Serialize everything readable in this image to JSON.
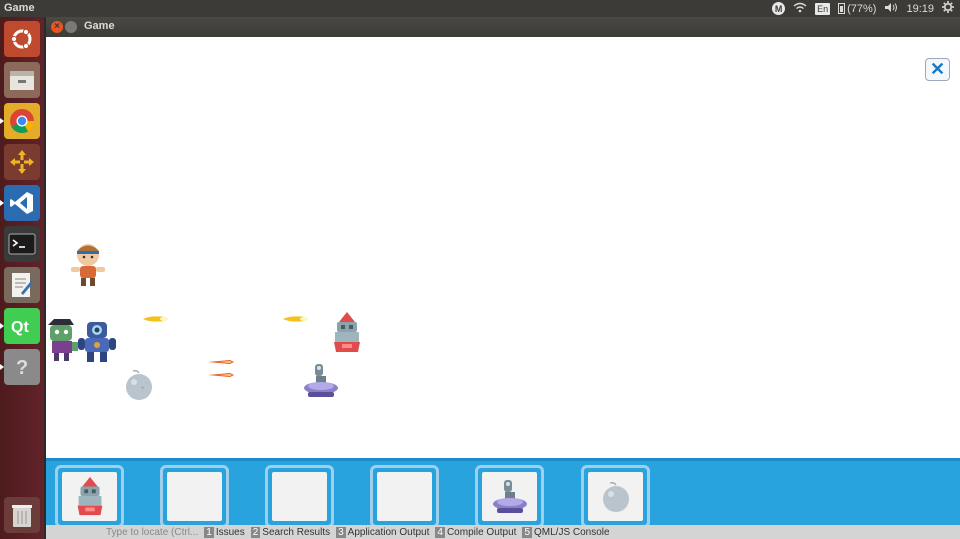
{
  "top_panel": {
    "app_title": "Game",
    "indicator_m": "M",
    "language": "En",
    "battery": "(77%)",
    "time": "19:19"
  },
  "launcher": {
    "items": [
      {
        "name": "ubuntu-dash-icon"
      },
      {
        "name": "files-icon"
      },
      {
        "name": "chrome-icon"
      },
      {
        "name": "game-app-icon"
      },
      {
        "name": "vscode-icon"
      },
      {
        "name": "terminal-icon"
      },
      {
        "name": "text-editor-icon"
      },
      {
        "name": "qt-creator-icon"
      },
      {
        "name": "unknown-app-icon"
      },
      {
        "name": "trash-icon"
      }
    ]
  },
  "window": {
    "title": "Game",
    "close_glyph": "×",
    "exit_glyph": "✕"
  },
  "game": {
    "enemies": [
      "hero-warrior",
      "zombie",
      "robot"
    ],
    "towers_on_field": [
      "red-turret",
      "laser-tower",
      "bomb"
    ],
    "tower_slots": [
      {
        "item": "red-turret"
      },
      {
        "item": ""
      },
      {
        "item": ""
      },
      {
        "item": ""
      },
      {
        "item": "laser-tower"
      },
      {
        "item": "bomb"
      }
    ]
  },
  "qt_strip": {
    "locate_placeholder": "Type to locate (Ctrl...",
    "tabs": [
      {
        "num": "1",
        "label": "Issues"
      },
      {
        "num": "2",
        "label": "Search Results"
      },
      {
        "num": "3",
        "label": "Application Output"
      },
      {
        "num": "4",
        "label": "Compile Output"
      },
      {
        "num": "5",
        "label": "QML/JS Console"
      }
    ]
  },
  "colors": {
    "panel": "#3c3b37",
    "launcher": "#5a1d20",
    "tower_bar": "#29a3de",
    "accent_close": "#e95420"
  }
}
